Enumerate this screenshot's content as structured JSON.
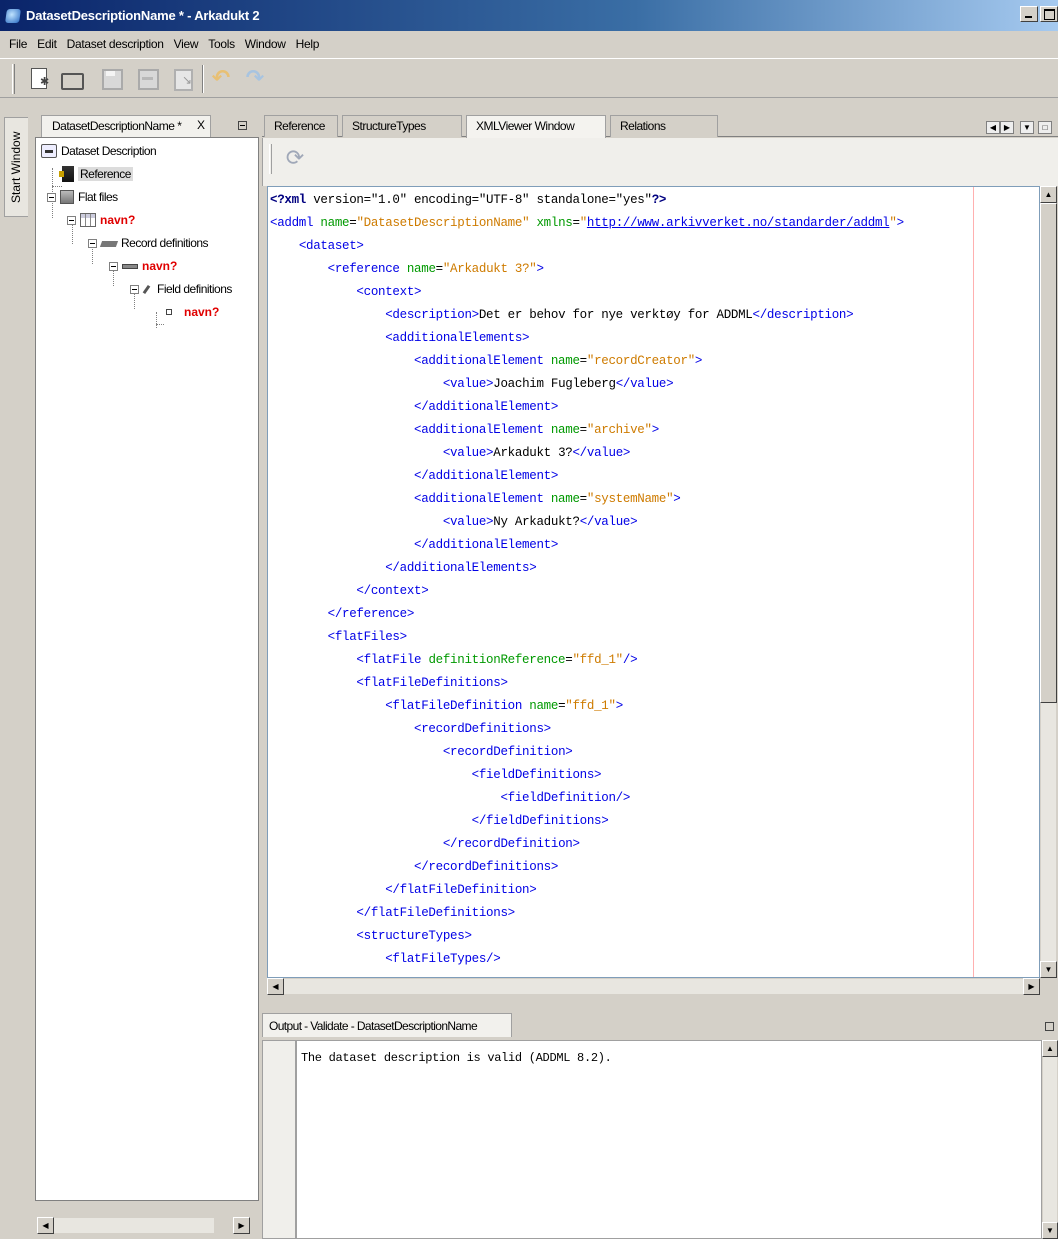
{
  "window": {
    "title": "DatasetDescriptionName * - Arkadukt 2"
  },
  "menu": [
    "File",
    "Edit",
    "Dataset description",
    "View",
    "Tools",
    "Window",
    "Help"
  ],
  "toolbar": {
    "icons": [
      "new-document-icon",
      "open-folder-icon",
      "save-icon",
      "save-all-icon",
      "properties-icon",
      "undo-icon",
      "redo-icon"
    ]
  },
  "start_window": {
    "label": "Start Window"
  },
  "tree_panel": {
    "tab_label": "DatasetDescriptionName *",
    "close_glyph": "X",
    "nodes": [
      {
        "label": "Dataset Description",
        "icon": "dataset-description-icon",
        "style": "normal"
      },
      {
        "label": "Reference",
        "icon": "reference-icon",
        "style": "selected"
      },
      {
        "label": "Flat files",
        "icon": "flat-files-icon",
        "style": "normal"
      },
      {
        "label": "navn?",
        "icon": "flat-file-icon",
        "style": "red"
      },
      {
        "label": "Record definitions",
        "icon": "record-definitions-icon",
        "style": "normal"
      },
      {
        "label": "navn?",
        "icon": "record-icon",
        "style": "red"
      },
      {
        "label": "Field definitions",
        "icon": "field-definitions-icon",
        "style": "normal"
      },
      {
        "label": "navn?",
        "icon": "field-icon",
        "style": "red"
      }
    ]
  },
  "editor": {
    "tabs": [
      "Reference",
      "StructureTypes",
      "XMLViewer Window",
      "Relations"
    ],
    "active_tab": "XMLViewer Window",
    "code_lines": [
      [
        [
          "pi",
          "<?xml"
        ],
        [
          "text",
          " version=\"1.0\" encoding=\"UTF-8\" standalone=\"yes\""
        ],
        [
          "pi",
          "?>"
        ]
      ],
      [
        [
          "tag",
          "<addml "
        ],
        [
          "attr",
          "name"
        ],
        [
          "text",
          "="
        ],
        [
          "str",
          "\"DatasetDescriptionName\""
        ],
        [
          "text",
          " "
        ],
        [
          "attr",
          "xmlns"
        ],
        [
          "text",
          "="
        ],
        [
          "str",
          "\""
        ],
        [
          "url",
          "http://www.arkivverket.no/standarder/addml"
        ],
        [
          "str",
          "\""
        ],
        [
          "tag",
          ">"
        ]
      ],
      [
        [
          "text",
          "    "
        ],
        [
          "tag",
          "<dataset>"
        ]
      ],
      [
        [
          "text",
          "        "
        ],
        [
          "tag",
          "<reference "
        ],
        [
          "attr",
          "name"
        ],
        [
          "text",
          "="
        ],
        [
          "str",
          "\"Arkadukt 3?\""
        ],
        [
          "tag",
          ">"
        ]
      ],
      [
        [
          "text",
          "            "
        ],
        [
          "tag",
          "<context>"
        ]
      ],
      [
        [
          "text",
          "                "
        ],
        [
          "tag",
          "<description>"
        ],
        [
          "text",
          "Det er behov for nye verktøy for ADDML"
        ],
        [
          "tag",
          "</description>"
        ]
      ],
      [
        [
          "text",
          "                "
        ],
        [
          "tag",
          "<additionalElements>"
        ]
      ],
      [
        [
          "text",
          "                    "
        ],
        [
          "tag",
          "<additionalElement "
        ],
        [
          "attr",
          "name"
        ],
        [
          "text",
          "="
        ],
        [
          "str",
          "\"recordCreator\""
        ],
        [
          "tag",
          ">"
        ]
      ],
      [
        [
          "text",
          "                        "
        ],
        [
          "tag",
          "<value>"
        ],
        [
          "text",
          "Joachim Fugleberg"
        ],
        [
          "tag",
          "</value>"
        ]
      ],
      [
        [
          "text",
          "                    "
        ],
        [
          "tag",
          "</additionalElement>"
        ]
      ],
      [
        [
          "text",
          "                    "
        ],
        [
          "tag",
          "<additionalElement "
        ],
        [
          "attr",
          "name"
        ],
        [
          "text",
          "="
        ],
        [
          "str",
          "\"archive\""
        ],
        [
          "tag",
          ">"
        ]
      ],
      [
        [
          "text",
          "                        "
        ],
        [
          "tag",
          "<value>"
        ],
        [
          "text",
          "Arkadukt 3?"
        ],
        [
          "tag",
          "</value>"
        ]
      ],
      [
        [
          "text",
          "                    "
        ],
        [
          "tag",
          "</additionalElement>"
        ]
      ],
      [
        [
          "text",
          "                    "
        ],
        [
          "tag",
          "<additionalElement "
        ],
        [
          "attr",
          "name"
        ],
        [
          "text",
          "="
        ],
        [
          "str",
          "\"systemName\""
        ],
        [
          "tag",
          ">"
        ]
      ],
      [
        [
          "text",
          "                        "
        ],
        [
          "tag",
          "<value>"
        ],
        [
          "text",
          "Ny Arkadukt?"
        ],
        [
          "tag",
          "</value>"
        ]
      ],
      [
        [
          "text",
          "                    "
        ],
        [
          "tag",
          "</additionalElement>"
        ]
      ],
      [
        [
          "text",
          "                "
        ],
        [
          "tag",
          "</additionalElements>"
        ]
      ],
      [
        [
          "text",
          "            "
        ],
        [
          "tag",
          "</context>"
        ]
      ],
      [
        [
          "text",
          "        "
        ],
        [
          "tag",
          "</reference>"
        ]
      ],
      [
        [
          "text",
          "        "
        ],
        [
          "tag",
          "<flatFiles>"
        ]
      ],
      [
        [
          "text",
          "            "
        ],
        [
          "tag",
          "<flatFile "
        ],
        [
          "attr",
          "definitionReference"
        ],
        [
          "text",
          "="
        ],
        [
          "str",
          "\"ffd_1\""
        ],
        [
          "tag",
          "/>"
        ]
      ],
      [
        [
          "text",
          "            "
        ],
        [
          "tag",
          "<flatFileDefinitions>"
        ]
      ],
      [
        [
          "text",
          "                "
        ],
        [
          "tag",
          "<flatFileDefinition "
        ],
        [
          "attr",
          "name"
        ],
        [
          "text",
          "="
        ],
        [
          "str",
          "\"ffd_1\""
        ],
        [
          "tag",
          ">"
        ]
      ],
      [
        [
          "text",
          "                    "
        ],
        [
          "tag",
          "<recordDefinitions>"
        ]
      ],
      [
        [
          "text",
          "                        "
        ],
        [
          "tag",
          "<recordDefinition>"
        ]
      ],
      [
        [
          "text",
          "                            "
        ],
        [
          "tag",
          "<fieldDefinitions>"
        ]
      ],
      [
        [
          "text",
          "                                "
        ],
        [
          "tag",
          "<fieldDefinition/>"
        ]
      ],
      [
        [
          "text",
          "                            "
        ],
        [
          "tag",
          "</fieldDefinitions>"
        ]
      ],
      [
        [
          "text",
          "                        "
        ],
        [
          "tag",
          "</recordDefinition>"
        ]
      ],
      [
        [
          "text",
          "                    "
        ],
        [
          "tag",
          "</recordDefinitions>"
        ]
      ],
      [
        [
          "text",
          "                "
        ],
        [
          "tag",
          "</flatFileDefinition>"
        ]
      ],
      [
        [
          "text",
          "            "
        ],
        [
          "tag",
          "</flatFileDefinitions>"
        ]
      ],
      [
        [
          "text",
          "            "
        ],
        [
          "tag",
          "<structureTypes>"
        ]
      ],
      [
        [
          "text",
          "                "
        ],
        [
          "tag",
          "<flatFileTypes/>"
        ]
      ]
    ]
  },
  "output": {
    "tab_label": "Output - Validate - DatasetDescriptionName",
    "message": "The dataset description is valid (ADDML 8.2)."
  }
}
